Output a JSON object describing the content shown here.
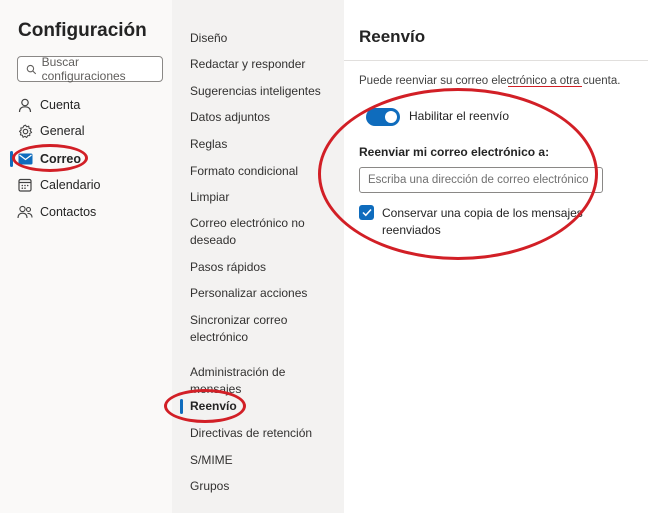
{
  "sidebar": {
    "title": "Configuración",
    "search_placeholder": "Buscar configuraciones",
    "items": [
      {
        "label": "Cuenta",
        "icon": "person-icon"
      },
      {
        "label": "General",
        "icon": "gear-icon"
      },
      {
        "label": "Correo",
        "icon": "mail-icon",
        "selected": true
      },
      {
        "label": "Calendario",
        "icon": "calendar-icon"
      },
      {
        "label": "Contactos",
        "icon": "people-icon"
      }
    ]
  },
  "submenu": {
    "items": [
      {
        "label": "Diseño"
      },
      {
        "label": "Redactar y responder"
      },
      {
        "label": "Sugerencias inteligentes"
      },
      {
        "label": "Datos adjuntos"
      },
      {
        "label": "Reglas"
      },
      {
        "label": "Formato condicional"
      },
      {
        "label": "Limpiar"
      },
      {
        "label": "Correo electrónico no deseado"
      },
      {
        "label": "Pasos rápidos"
      },
      {
        "label": "Personalizar acciones"
      },
      {
        "label": "Sincronizar correo electrónico"
      },
      {
        "label": "Administración de mensajes"
      },
      {
        "label": "Reenvío",
        "selected": true
      },
      {
        "label": "Directivas de retención"
      },
      {
        "label": "S/MIME"
      },
      {
        "label": "Grupos"
      }
    ]
  },
  "panel": {
    "title": "Reenvío",
    "description": "Puede reenviar su correo electrónico a otra cuenta.",
    "toggle_label": "Habilitar el reenvío",
    "toggle_on": true,
    "field_label": "Reenviar mi correo electrónico a:",
    "email_value": "",
    "email_placeholder": "Escriba una dirección de correo electrónico",
    "checkbox_label": "Conservar una copia de los mensajes reenviados",
    "checkbox_checked": true
  },
  "colors": {
    "accent": "#0f6cbd",
    "annotation": "#d21f26"
  }
}
